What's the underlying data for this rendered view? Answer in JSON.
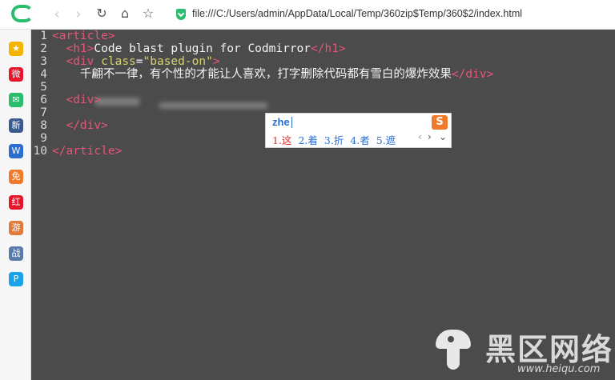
{
  "browser": {
    "url": "file:///C:/Users/admin/AppData/Local/Temp/360zip$Temp/360$2/index.html",
    "back_icon": "chevron-left-icon",
    "forward_icon": "chevron-right-icon",
    "reload_icon": "reload-icon",
    "home_icon": "home-icon",
    "star_icon": "star-icon",
    "secure_icon": "shield-icon"
  },
  "sidebar": {
    "items": [
      {
        "icon": "favorites-icon",
        "label": "★",
        "color": "#f5b400"
      },
      {
        "icon": "weibo-icon",
        "label": "微",
        "color": "#e6162d"
      },
      {
        "icon": "mail-icon",
        "label": "✉",
        "color": "#2bbd6e"
      },
      {
        "icon": "news-icon",
        "label": "新",
        "color": "#3b5b8c"
      },
      {
        "icon": "doc-icon",
        "label": "W",
        "color": "#2a6fd0"
      },
      {
        "icon": "novel-icon",
        "label": "免",
        "color": "#f07a2c"
      },
      {
        "icon": "shop-icon",
        "label": "红",
        "color": "#e6162d"
      },
      {
        "icon": "game-icon",
        "label": "游",
        "color": "#e07a3a"
      },
      {
        "icon": "game2-icon",
        "label": "战",
        "color": "#5a7aa8"
      },
      {
        "icon": "pay-icon",
        "label": "P",
        "color": "#1aa3e8"
      }
    ]
  },
  "editor": {
    "lines": [
      {
        "n": "1",
        "parts": [
          [
            "tag",
            "<article>"
          ]
        ]
      },
      {
        "n": "2",
        "parts": [
          [
            "txt",
            "  "
          ],
          [
            "tag",
            "<h1>"
          ],
          [
            "txt",
            "Code blast plugin for Codmirror"
          ],
          [
            "tag",
            "</h1>"
          ]
        ]
      },
      {
        "n": "3",
        "parts": [
          [
            "txt",
            "  "
          ],
          [
            "tag",
            "<div "
          ],
          [
            "attr",
            "class"
          ],
          [
            "txt",
            "="
          ],
          [
            "str",
            "\"based-on\""
          ],
          [
            "tag",
            ">"
          ]
        ]
      },
      {
        "n": "4",
        "parts": [
          [
            "txt",
            "    千翩不一律，有个性的才能让人喜欢，打字删除代码都有雪白的爆炸效果"
          ],
          [
            "tag",
            "</div>"
          ]
        ]
      },
      {
        "n": "5",
        "parts": []
      },
      {
        "n": "6",
        "parts": [
          [
            "txt",
            "  "
          ],
          [
            "tag",
            "<div>"
          ]
        ]
      },
      {
        "n": "7",
        "parts": []
      },
      {
        "n": "8",
        "parts": [
          [
            "txt",
            "  "
          ],
          [
            "tag",
            "</div>"
          ]
        ]
      },
      {
        "n": "9",
        "parts": []
      },
      {
        "n": "10",
        "parts": [
          [
            "tag",
            "</article>"
          ]
        ]
      }
    ]
  },
  "ime": {
    "input": "zhe",
    "candidates": [
      "1.这",
      "2.着",
      "3.折",
      "4.者",
      "5.遮"
    ],
    "logo": "S",
    "prev": "‹",
    "next": "›",
    "more": "⌄"
  },
  "watermark": {
    "title": "黑区网络",
    "url": "www.heiqu.com"
  }
}
